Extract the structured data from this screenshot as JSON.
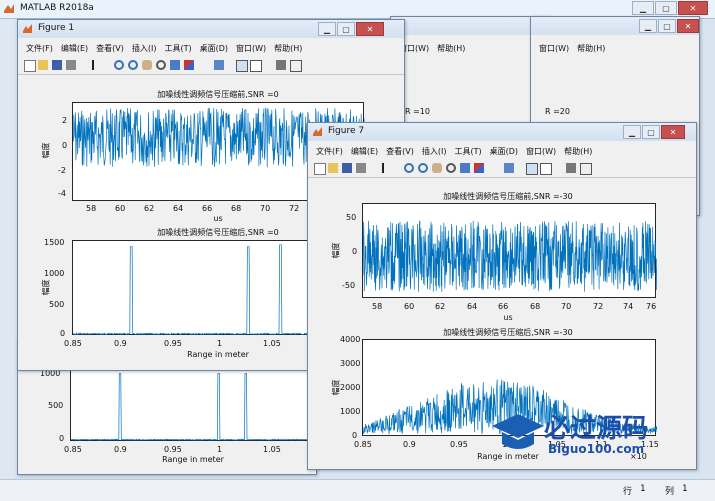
{
  "app": {
    "title": "MATLAB R2018a"
  },
  "status": {
    "row_label": "行",
    "row_value": "1",
    "col_label": "列",
    "col_value": "1"
  },
  "menu": [
    "文件(F)",
    "编辑(E)",
    "查看(V)",
    "插入(I)",
    "工具(T)",
    "桌面(D)",
    "窗口(W)",
    "帮助(H)"
  ],
  "bg_menu": [
    "窗口(W)",
    "帮助(H)"
  ],
  "bg_snr": [
    "R =10",
    "R =20"
  ],
  "fig1": {
    "title": "Figure 1",
    "top_title": "加噪线性调频信号压缩前,SNR =0",
    "top_ylabel": "幅度",
    "top_xlabel": "us",
    "top_xticks": [
      "58",
      "60",
      "62",
      "64",
      "66",
      "68",
      "70",
      "72"
    ],
    "top_yticks": [
      "2",
      "0",
      "-2",
      "-4"
    ],
    "bot_title": "加噪线性调频信号压缩后,SNR =0",
    "bot_ylabel": "幅度",
    "bot_xlabel": "Range in meter",
    "bot_xticks": [
      "0.85",
      "0.9",
      "0.95",
      "1",
      "1.05"
    ],
    "bot_yticks": [
      "1500",
      "1000",
      "500",
      "0"
    ]
  },
  "figbehind": {
    "yticks": [
      "1000",
      "500",
      "0"
    ],
    "xticks": [
      "0.85",
      "0.9",
      "0.95",
      "1",
      "1.05"
    ],
    "xlabel": "Range in meter"
  },
  "fig7": {
    "title": "Figure 7",
    "top_title": "加噪线性调频信号压缩前,SNR =-30",
    "top_ylabel": "幅度",
    "top_xlabel": "us",
    "top_xticks": [
      "58",
      "60",
      "62",
      "64",
      "66",
      "68",
      "70",
      "72",
      "74",
      "76"
    ],
    "top_yticks": [
      "50",
      "0",
      "-50"
    ],
    "bot_title": "加噪线性调频信号压缩后,SNR =-30",
    "bot_ylabel": "幅度",
    "bot_xlabel": "Range in meter",
    "bot_xticks": [
      "0.85",
      "0.9",
      "0.95",
      "1",
      "1.05",
      "1.1",
      "1.15"
    ],
    "bot_yticks": [
      "4000",
      "3000",
      "2000",
      "1000",
      "0"
    ],
    "bot_exp": "×10"
  },
  "watermark": {
    "cn": "必过源码",
    "en": "Biguo100.com"
  },
  "colors": {
    "line": "#0072BD",
    "titlebar": "#dbe6f3",
    "close": "#c75050"
  }
}
